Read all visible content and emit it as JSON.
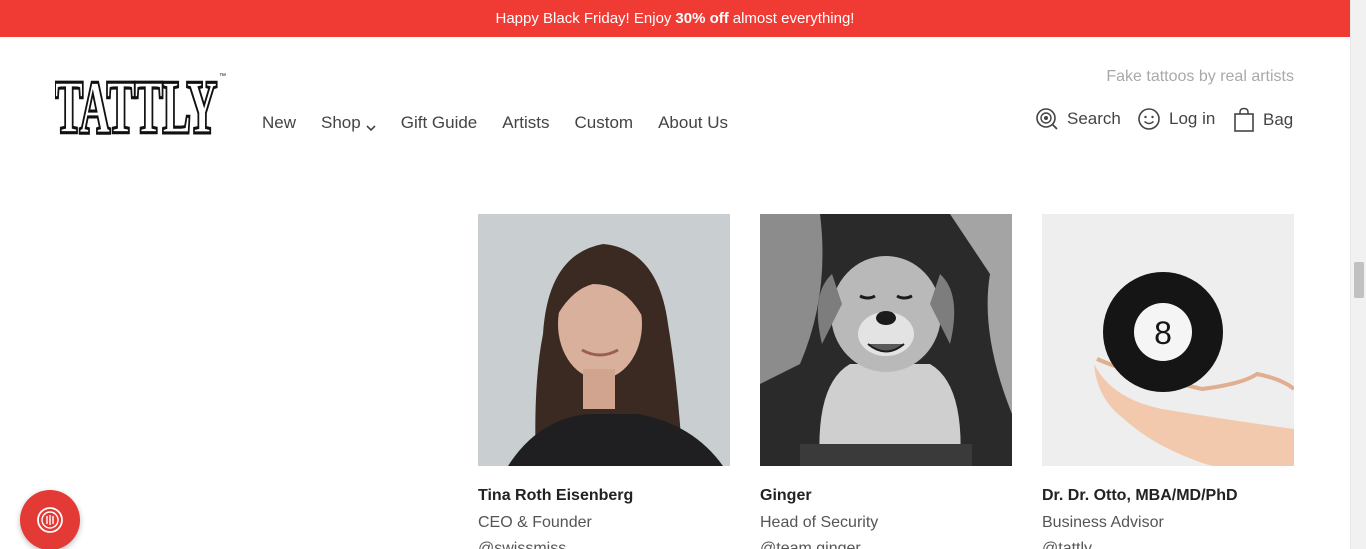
{
  "promo": {
    "pre": "Happy Black Friday! Enjoy",
    "bold": "30% off",
    "post": "almost everything!"
  },
  "header": {
    "logo_text": "TATTLY",
    "tagline": "Fake tattoos by real artists"
  },
  "nav": {
    "new": "New",
    "shop": "Shop",
    "gift_guide": "Gift Guide",
    "artists": "Artists",
    "custom": "Custom",
    "about": "About Us"
  },
  "utility": {
    "search": "Search",
    "login": "Log in",
    "bag": "Bag"
  },
  "team": [
    {
      "name": "Tina Roth Eisenberg",
      "role": "CEO & Founder",
      "handle": "@swissmiss"
    },
    {
      "name": "Ginger",
      "role": "Head of Security",
      "handle": "@team.ginger"
    },
    {
      "name": "Dr. Dr. Otto, MBA/MD/PhD",
      "role": "Business Advisor",
      "handle": "@tattly"
    }
  ],
  "icons": {
    "search": "search-icon",
    "login": "smiley-icon",
    "bag": "bag-icon",
    "shop_dropdown": "chevron-down-icon",
    "help": "help-icon"
  },
  "colors": {
    "promo_bg": "#f03a34",
    "help_button": "#e33a35"
  }
}
